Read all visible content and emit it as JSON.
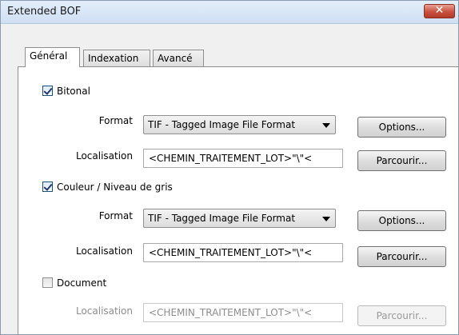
{
  "window": {
    "title": "Extended BOF"
  },
  "tabs": [
    {
      "label": "Général",
      "active": true
    },
    {
      "label": "Indexation",
      "active": false
    },
    {
      "label": "Avancé",
      "active": false
    }
  ],
  "bitonal": {
    "label": "Bitonal",
    "checked": true,
    "format_label": "Format",
    "format_value": "TIF - Tagged Image File Format",
    "options_button": "Options...",
    "location_label": "Localisation",
    "location_value": "<CHEMIN_TRAITEMENT_LOT>\"\\\"<",
    "browse_button": "Parcourir..."
  },
  "color": {
    "label": "Couleur / Niveau de gris",
    "checked": true,
    "format_label": "Format",
    "format_value": "TIF - Tagged Image File Format",
    "options_button": "Options...",
    "location_label": "Localisation",
    "location_value": "<CHEMIN_TRAITEMENT_LOT>\"\\\"<",
    "browse_button": "Parcourir..."
  },
  "document": {
    "label": "Document",
    "checked": false,
    "location_label": "Localisation",
    "location_value": "<CHEMIN_TRAITEMENT_LOT>\"\\\"<",
    "browse_button": "Parcourir..."
  }
}
